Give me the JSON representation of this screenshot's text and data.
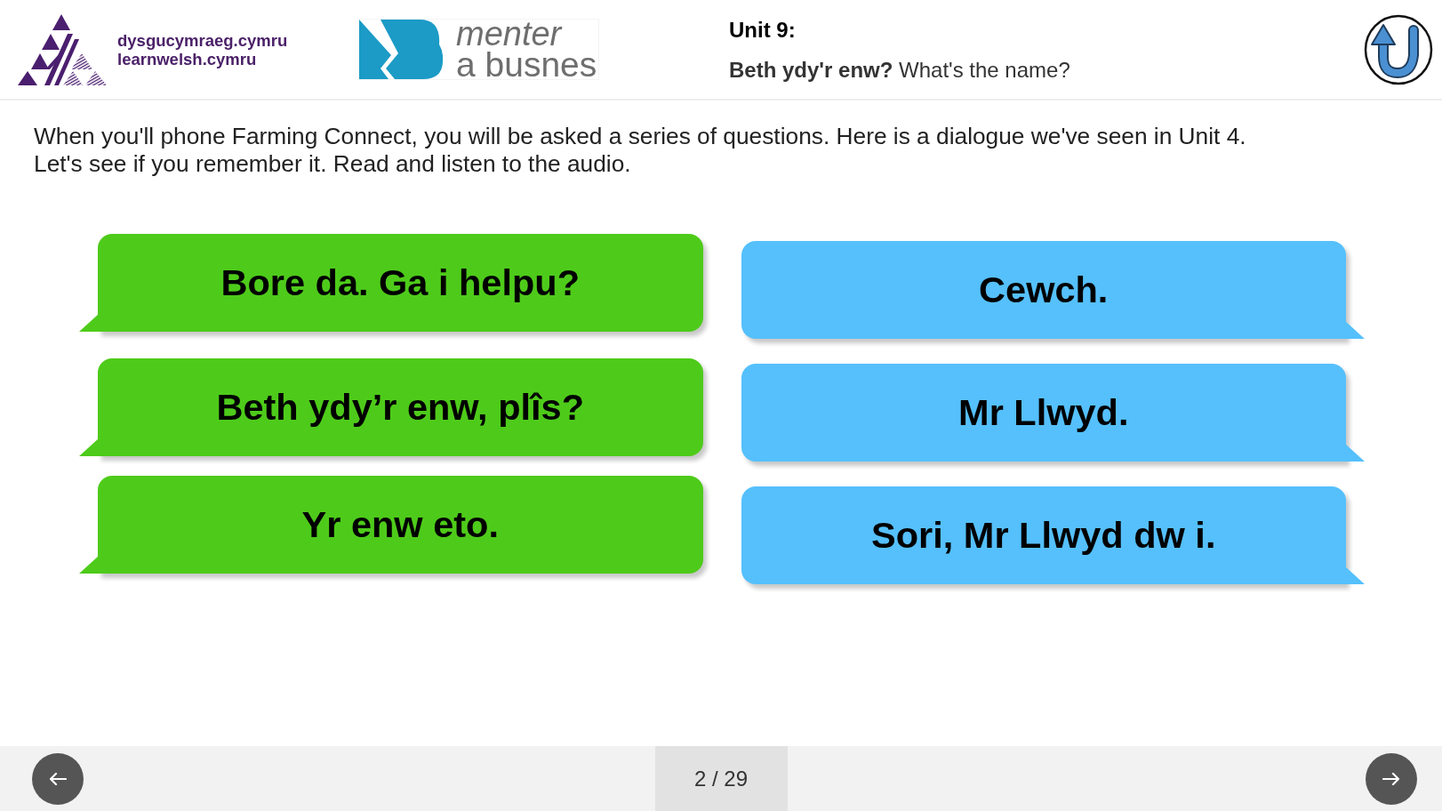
{
  "header": {
    "logo_lines": [
      "dysgucymraeg.cymru",
      "learnwelsh.cymru"
    ],
    "partner_logo": {
      "line_1": "menter",
      "line_2": "a busnes"
    },
    "unit_title": "Unit 9:",
    "subtitle": "**Beth ydy'r enw?** What's the name?"
  },
  "instructions": "When you'll phone Farming Connect, you will be asked a series of questions. Here is a dialogue we've seen in Unit 4.\nLet's see if you remember it. Read and listen to the audio.",
  "dialogue_columns": [
    {
      "kind": "left",
      "color": "#4ecb1a",
      "bubbles": [
        "Bore da. Ga i helpu?",
        "Beth ydy’r enw, plîs?",
        "Yr enw eto."
      ]
    },
    {
      "kind": "right",
      "color": "#55c0fc",
      "bubbles": [
        "Cewch.",
        "Mr Llwyd.",
        "Sori, Mr Llwyd dw i."
      ]
    }
  ],
  "footer": {
    "page_counter": "2 / 29"
  }
}
